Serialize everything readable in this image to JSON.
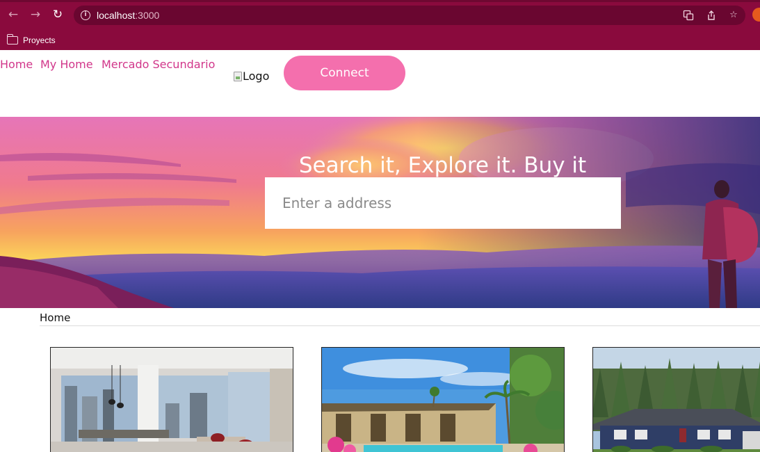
{
  "browser": {
    "url_host": "localhost",
    "url_port": ":3000",
    "bookmark_folder": "Proyects",
    "icons": [
      "back-icon",
      "forward-icon",
      "reload-icon",
      "info-icon",
      "translate-icon",
      "share-icon",
      "star-icon",
      "folder-icon"
    ]
  },
  "nav": {
    "links": [
      "Home",
      "My Home",
      "Mercado Secundario"
    ],
    "logo_alt": "Logo",
    "connect_label": "Connect"
  },
  "hero": {
    "title": "Search it, Explore it. Buy it",
    "search_placeholder": "Enter a address"
  },
  "breadcrumb": {
    "current": "Home"
  },
  "listings": {
    "cards": [
      {
        "image": "modern-apartment-interior"
      },
      {
        "image": "pool-courtyard-house"
      },
      {
        "image": "suburban-house-forest"
      }
    ]
  },
  "colors": {
    "browser_chrome": "#8a0a3d",
    "accent_pink": "#f46fad",
    "nav_link": "#d1368a"
  }
}
